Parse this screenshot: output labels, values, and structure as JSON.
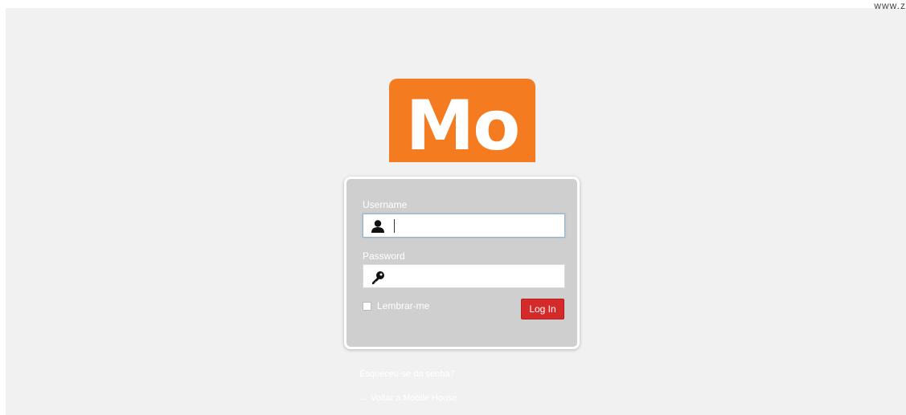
{
  "watermark": "www.z",
  "logo": {
    "text": "Mo",
    "color": "#f47b20"
  },
  "login_form": {
    "username_label": "Username",
    "username_value": "",
    "password_label": "Password",
    "password_value": "",
    "remember_label": "Lembrar-me",
    "remember_checked": false,
    "submit_label": "Log In"
  },
  "links": {
    "forgot_password": "Esqueceu-se da senha?",
    "back_to_site": "← Voltar a Mobile House"
  },
  "colors": {
    "accent_button": "#d42a2a",
    "panel": "#cfcfcf",
    "background": "#f1f1f1"
  },
  "icons": {
    "username": "user-icon",
    "password": "key-icon"
  }
}
